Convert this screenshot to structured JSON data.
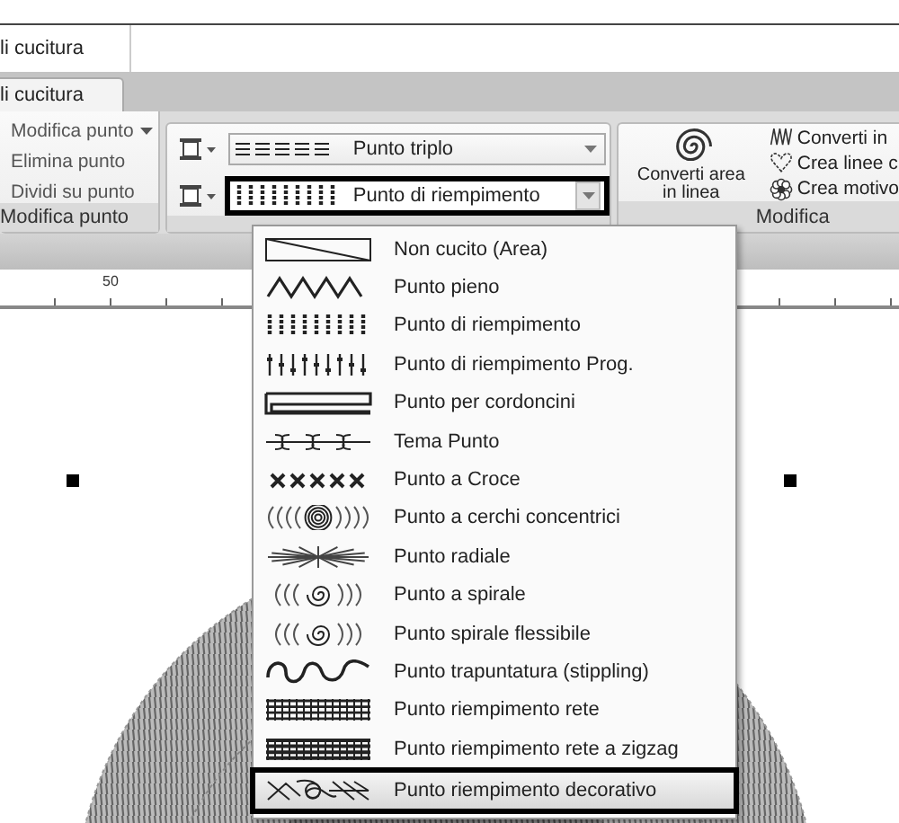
{
  "doc_tab": {
    "label": "li cucitura"
  },
  "ribbon_tabs": [
    {
      "label": "li cucitura",
      "selected": true
    }
  ],
  "edit_group": {
    "title": "Modifica punto",
    "items": [
      {
        "label": "Modifica punto",
        "has_menu": true
      },
      {
        "label": "Elimina punto",
        "has_menu": false
      },
      {
        "label": "Dividi su punto",
        "has_menu": false
      }
    ]
  },
  "stitch_group": {
    "rows": [
      {
        "kind": "triple",
        "label": "Punto triplo",
        "focused": false
      },
      {
        "kind": "fill",
        "label": "Punto di riempimento",
        "focused": true
      }
    ]
  },
  "modify_group": {
    "title": "Modifica",
    "big_button": "Converti area in linea",
    "items": [
      {
        "kind": "zigzag",
        "label": "Converti in"
      },
      {
        "kind": "heart",
        "label": "Crea linee c"
      },
      {
        "kind": "flower",
        "label": "Crea motivo"
      }
    ]
  },
  "ruler": {
    "label": "50"
  },
  "stitch_menu": {
    "items": [
      {
        "kind": "area",
        "label": "Non cucito (Area)",
        "selected": false
      },
      {
        "kind": "satin",
        "label": "Punto pieno",
        "selected": false
      },
      {
        "kind": "fill",
        "label": "Punto di riempimento",
        "selected": false
      },
      {
        "kind": "prog",
        "label": "Punto di riempimento Prog.",
        "selected": false
      },
      {
        "kind": "cording",
        "label": "Punto per cordoncini",
        "selected": false
      },
      {
        "kind": "motif",
        "label": "Tema Punto",
        "selected": false
      },
      {
        "kind": "cross",
        "label": "Punto a Croce",
        "selected": false
      },
      {
        "kind": "concentric",
        "label": "Punto a cerchi concentrici",
        "selected": false
      },
      {
        "kind": "radial",
        "label": "Punto radiale",
        "selected": false
      },
      {
        "kind": "spiral",
        "label": "Punto a spirale",
        "selected": false
      },
      {
        "kind": "spiral",
        "label": "Punto spirale flessibile",
        "selected": false
      },
      {
        "kind": "stipple",
        "label": "Punto trapuntatura (stippling)",
        "selected": false
      },
      {
        "kind": "net",
        "label": "Punto riempimento rete",
        "selected": false
      },
      {
        "kind": "zignet",
        "label": "Punto riempimento rete a zigzag",
        "selected": false
      },
      {
        "kind": "decorative",
        "label": "Punto riempimento decorativo",
        "selected": true
      }
    ]
  }
}
